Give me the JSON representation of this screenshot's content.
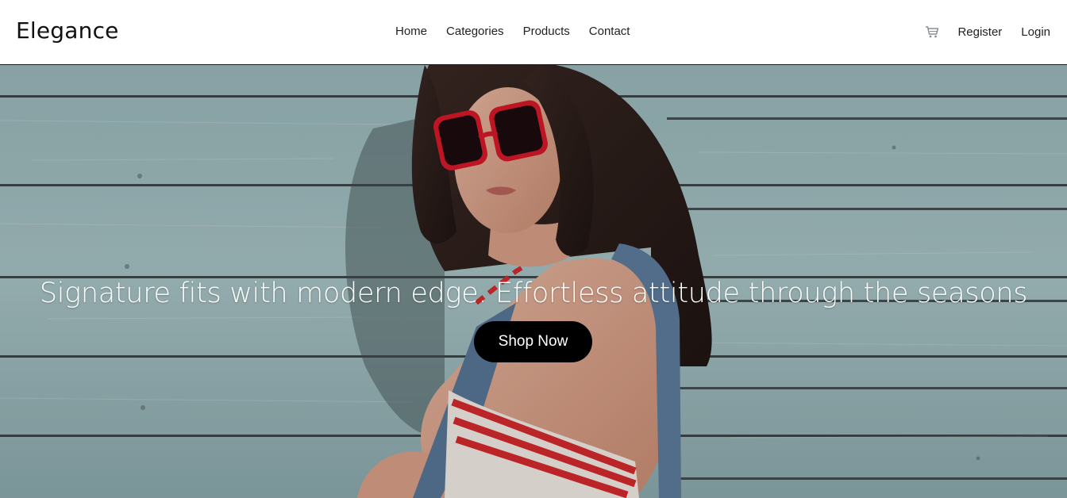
{
  "header": {
    "brand": "Elegance",
    "nav": {
      "home": "Home",
      "categories": "Categories",
      "products": "Products",
      "contact": "Contact"
    },
    "account": {
      "cart_icon": "shopping-cart-icon",
      "register": "Register",
      "login": "Login"
    }
  },
  "hero": {
    "caption": "Signature fits with modern edge. Effortless attitude through the seasons",
    "cta_label": "Shop Now",
    "image": "woman-red-sunglasses-teal-wood-wall"
  },
  "colors": {
    "header_bg": "#ffffff",
    "text_dark": "#222222",
    "wood_teal": "#8fb0b4",
    "button_bg": "#000000",
    "button_text": "#ffffff",
    "sunglasses_red": "#d8182a"
  }
}
